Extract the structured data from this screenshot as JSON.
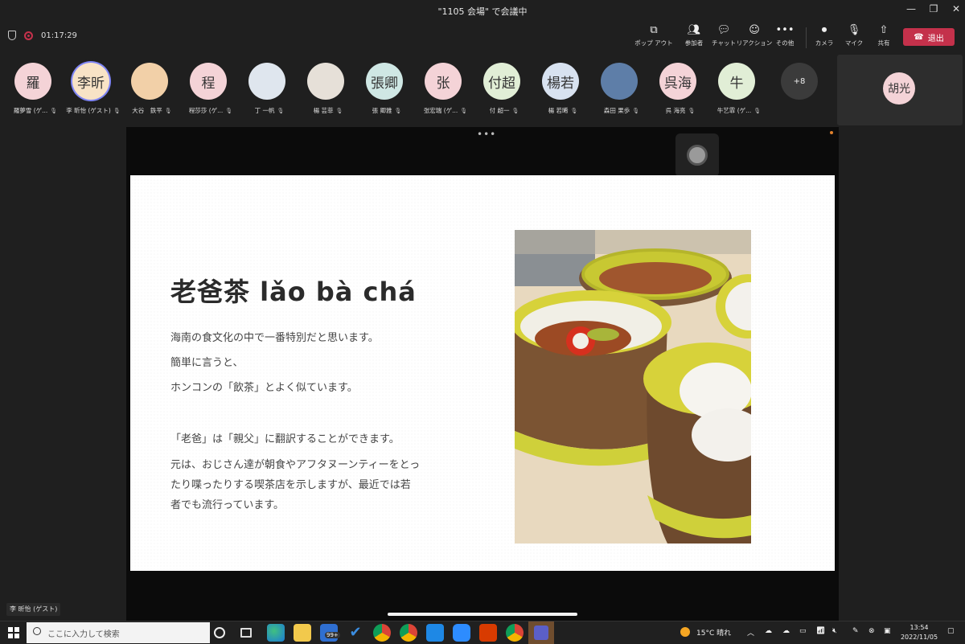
{
  "window": {
    "title": "\"1105 会場\" で会議中"
  },
  "toolbar": {
    "timer": "01:17:29",
    "buttons": [
      {
        "label": "ポップ アウト",
        "icon": "popout-icon"
      },
      {
        "label": "参加者",
        "icon": "participants-icon"
      },
      {
        "label": "チャット",
        "icon": "chat-icon"
      },
      {
        "label": "リアクション",
        "icon": "reaction-icon"
      },
      {
        "label": "その他",
        "icon": "more-icon"
      },
      {
        "label": "カメラ",
        "icon": "camera-off-icon"
      },
      {
        "label": "マイク",
        "icon": "mic-off-icon"
      },
      {
        "label": "共有",
        "icon": "share-icon"
      }
    ],
    "leave_label": "退出"
  },
  "participants": [
    {
      "initials": "羅",
      "name": "羅夢雪 (ゲ...",
      "color": "#f4d3d7"
    },
    {
      "initials": "李昕",
      "name": "李 昕怡 (ゲスト)",
      "color": "#f8e3c6"
    },
    {
      "initials": "",
      "name": "大谷　鉄平",
      "color": "#f2d0a8"
    },
    {
      "initials": "程",
      "name": "程莎莎 (ゲ...",
      "color": "#f4d3d7"
    },
    {
      "initials": "",
      "name": "丁 一帆",
      "color": "#dfe6ee"
    },
    {
      "initials": "",
      "name": "楊 芸菲",
      "color": "#e6e0d8"
    },
    {
      "initials": "張卿",
      "name": "張 卿雅",
      "color": "#cfe7e4"
    },
    {
      "initials": "张",
      "name": "张宏瑞 (ゲ...",
      "color": "#f4d3d7"
    },
    {
      "initials": "付超",
      "name": "付 超一",
      "color": "#e1eed6"
    },
    {
      "initials": "楊若",
      "name": "楊 若晞",
      "color": "#d8e2f0"
    },
    {
      "initials": "",
      "name": "森田 果歩",
      "color": "#5e7ea8"
    },
    {
      "initials": "呉海",
      "name": "呉 海亮",
      "color": "#f4d3d7"
    },
    {
      "initials": "牛",
      "name": "牛艺霏 (ゲ...",
      "color": "#e1eed6"
    }
  ],
  "overflow_count": "+8",
  "self_view": {
    "initials": "胡光"
  },
  "slide": {
    "title": "老爸茶  lǎo bà chá",
    "paragraphs": [
      "海南の食文化の中で一番特別だと思います。",
      "簡単に言うと、",
      "ホンコンの「飲茶」とよく似ています。",
      "「老爸」は「親父」に翻訳することができます。",
      "元は、おじさん達が朝食やアフタヌーンティーをとっ",
      "たり喋ったりする喫茶店を示しますが、最近では若",
      "者でも流行っています。"
    ]
  },
  "pinned_name": "李 昕怡 (ゲスト)",
  "taskbar": {
    "search_placeholder": "ここに入力して検索",
    "weather": "15°C 晴れ",
    "time": "13:54",
    "date": "2022/11/05",
    "mail_badge": "99+"
  }
}
